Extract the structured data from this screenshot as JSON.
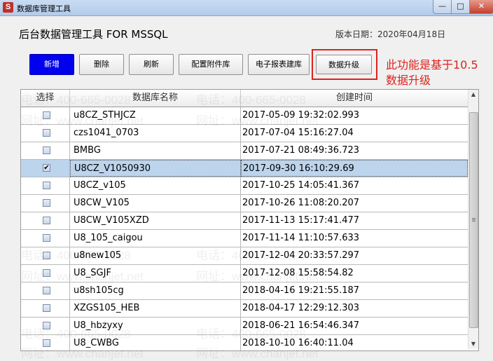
{
  "window": {
    "title": "数据库管理工具",
    "icon_letter": "S",
    "min_glyph": "—",
    "max_glyph": "□",
    "close_glyph": "✕"
  },
  "header": {
    "app_title": "后台数据管理工具 FOR MSSQL",
    "version": "版本日期：2020年04月18日"
  },
  "toolbar": {
    "new_label": "新增",
    "delete_label": "删除",
    "refresh_label": "刷新",
    "config_label": "配置附件库",
    "report_label": "电子报表建库",
    "upgrade_label": "数据升级"
  },
  "annotation": {
    "line1": "此功能是基于10.5",
    "line2": "数据升级"
  },
  "table": {
    "columns": [
      "选择",
      "数据库名称",
      "创建时间"
    ],
    "rows": [
      {
        "checked": false,
        "name": "u8CZ_STHJCZ",
        "time": "2017-05-09 19:32:02.993"
      },
      {
        "checked": false,
        "name": "czs1041_0703",
        "time": "2017-07-04 15:16:27.04"
      },
      {
        "checked": false,
        "name": "BMBG",
        "time": "2017-07-21 08:49:36.723"
      },
      {
        "checked": true,
        "name": "U8CZ_V1050930",
        "time": "2017-09-30 16:10:29.69"
      },
      {
        "checked": false,
        "name": "U8CZ_v105",
        "time": "2017-10-25 14:05:41.367"
      },
      {
        "checked": false,
        "name": "U8CW_V105",
        "time": "2017-10-26 11:08:20.207"
      },
      {
        "checked": false,
        "name": "U8CW_V105XZD",
        "time": "2017-11-13 15:17:41.477"
      },
      {
        "checked": false,
        "name": "U8_105_caigou",
        "time": "2017-11-14 11:10:57.633"
      },
      {
        "checked": false,
        "name": "u8new105",
        "time": "2017-12-04 20:33:57.297"
      },
      {
        "checked": false,
        "name": "U8_SGJF",
        "time": "2017-12-08 15:58:54.82"
      },
      {
        "checked": false,
        "name": "u8sh105cg",
        "time": "2018-04-16 19:21:55.187"
      },
      {
        "checked": false,
        "name": "XZGS105_HEB",
        "time": "2018-04-17 12:29:12.303"
      },
      {
        "checked": false,
        "name": "U8_hbzyxy",
        "time": "2018-06-21 16:54:46.347"
      },
      {
        "checked": false,
        "name": "U8_CWBG",
        "time": "2018-10-10 16:40:11.04"
      }
    ],
    "selected_index": 3
  },
  "scrollbar": {
    "up_glyph": "▲",
    "down_glyph": "▼"
  },
  "watermark": {
    "phone": "电话：400-665-0028",
    "site": "网址：www.chanjet.net"
  },
  "colors": {
    "primary_button": "#0000ee",
    "annotation_red": "#e0211b",
    "selected_row": "#bcd4ec"
  }
}
